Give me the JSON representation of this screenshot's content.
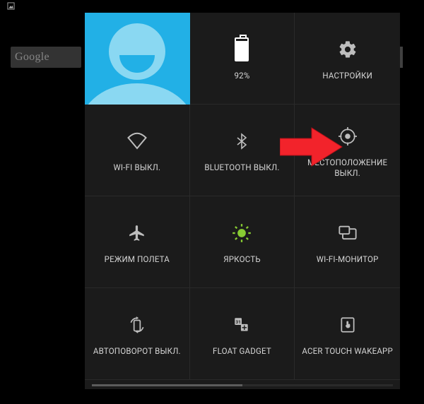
{
  "status": {
    "icon_name": "image-notification"
  },
  "backdrop": {
    "search_label": "Google"
  },
  "tiles": {
    "user": {
      "label": ""
    },
    "battery": {
      "label": "92%",
      "fill_pct": 92
    },
    "settings": {
      "label": "НАСТРОЙКИ"
    },
    "wifi": {
      "label": "WI-FI ВЫКЛ."
    },
    "bluetooth": {
      "label": "BLUETOOTH ВЫКЛ."
    },
    "location": {
      "label": "МЕСТОПОЛОЖЕНИЕ ВЫКЛ."
    },
    "airplane": {
      "label": "РЕЖИМ ПОЛЕТА"
    },
    "brightness": {
      "label": "ЯРКОСТЬ"
    },
    "wifi_monitor": {
      "label": "WI-FI-МОНИТОР"
    },
    "autorotate": {
      "label": "АВТОПОВОРОТ ВЫКЛ."
    },
    "float_gadget": {
      "label": "FLOAT GADGET"
    },
    "touch_wake": {
      "label": "ACER TOUCH WAKEAPP"
    }
  },
  "colors": {
    "accent": "#22b0e6",
    "brightness_icon": "#88cc33",
    "arrow": "#f2232b"
  }
}
